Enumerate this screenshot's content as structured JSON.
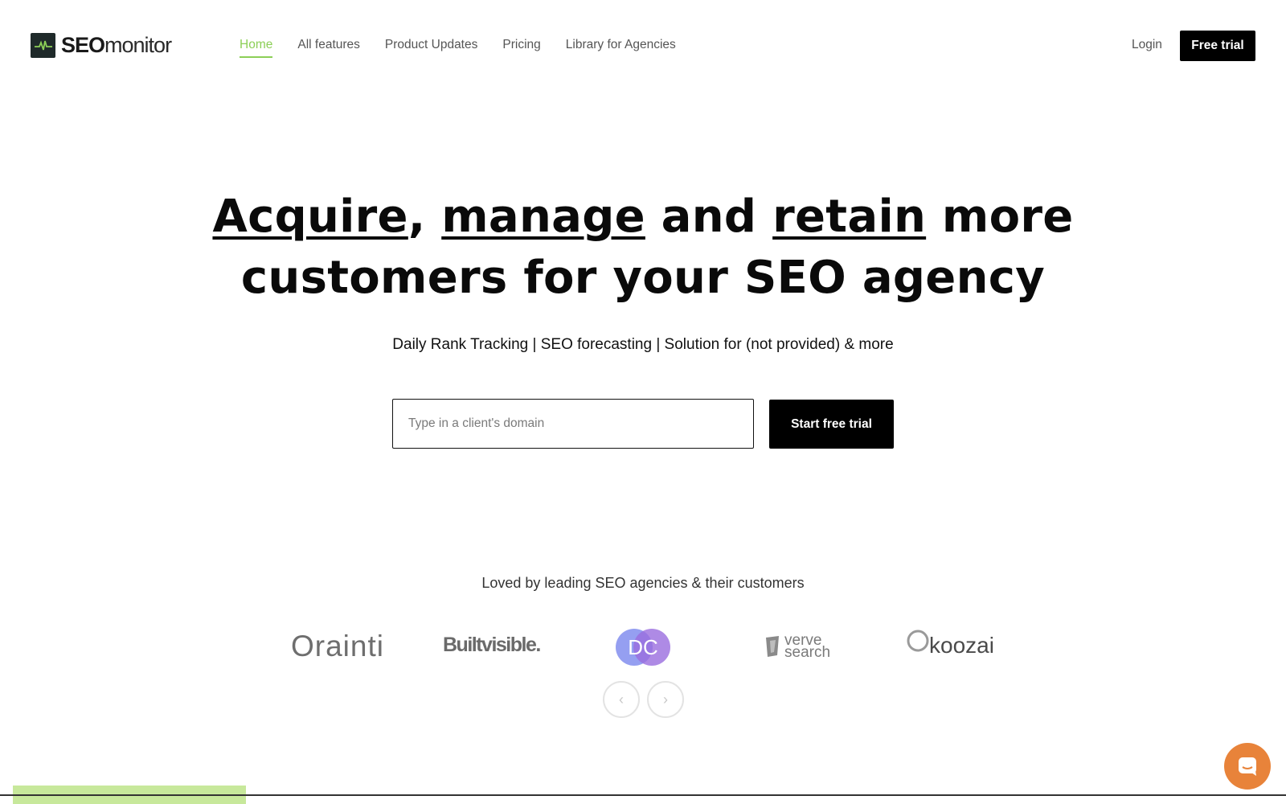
{
  "brand": {
    "name_bold": "SEO",
    "name_light": "monitor"
  },
  "nav": {
    "items": [
      {
        "label": "Home",
        "active": true
      },
      {
        "label": "All features",
        "active": false
      },
      {
        "label": "Product Updates",
        "active": false
      },
      {
        "label": "Pricing",
        "active": false
      },
      {
        "label": "Library for Agencies",
        "active": false
      }
    ],
    "login": "Login",
    "free_trial": "Free trial"
  },
  "hero": {
    "headline_w1": "Acquire",
    "headline_sep1": ", ",
    "headline_w2": "manage",
    "headline_sep2": " and ",
    "headline_w3": "retain",
    "headline_rest1": " more",
    "headline_line2": "customers for your SEO agency",
    "subtitle": "Daily Rank Tracking | SEO forecasting | Solution for (not provided) & more",
    "input_placeholder": "Type in a client's domain",
    "cta": "Start free trial"
  },
  "social_proof": {
    "heading": "Loved by leading SEO agencies & their customers",
    "logos": [
      {
        "name": "Orainti"
      },
      {
        "name": "Builtvisible."
      },
      {
        "name": "DC"
      },
      {
        "name_line1": "verve",
        "name_line2": "search"
      },
      {
        "name": "koozai"
      }
    ],
    "prev_icon": "chevron-left-icon",
    "next_icon": "chevron-right-icon"
  },
  "colors": {
    "accent": "#8ccf57",
    "primary_button": "#000000",
    "chat": "#e8833a",
    "bottom_bar": "#c7e89b"
  }
}
